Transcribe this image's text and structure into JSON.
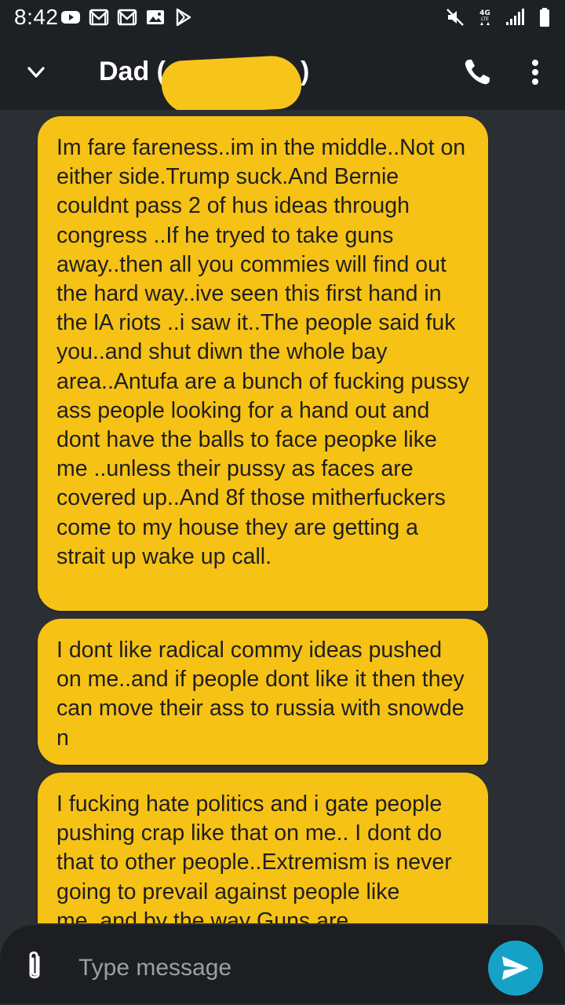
{
  "status_bar": {
    "time": "8:42",
    "left_icons": [
      "youtube-icon",
      "gmail-icon",
      "gmail-icon",
      "gallery-icon",
      "play-store-icon"
    ],
    "right_icons": [
      "mute-icon",
      "lte-icon",
      "signal-icon",
      "battery-icon"
    ]
  },
  "app_bar": {
    "title": "Dad (",
    "title_close": ")",
    "redaction_color": "#f7c41a"
  },
  "messages": [
    {
      "text": "Im fare fareness..im in the middle..Not on either side.Trump suck.And Bernie couldnt pass 2 of hus ideas through congress ..If he tryed to take guns away..then all you commies will find out the hard way..ive seen this first hand in the lA riots ..i saw it..The people said fuk you..and shut diwn the whole bay area..Antufa are a bunch of fucking pussy ass people looking for a hand out and dont have the balls to face peopke like me ..unless their pussy as faces are covered up..And 8f those mitherfuckers come to my house they are getting a strait up wake up call."
    },
    {
      "text": "I dont like radical commy ideas pushed on me..and if people dont like it then they can move their ass to russia with snowde n"
    },
    {
      "text": "I fucking hate politics and i gate people pushing crap like that on me.. I dont do that to other people..Extremism is never going to prevail against people like me..and by the way Guns are"
    }
  ],
  "composer": {
    "placeholder": "Type message"
  },
  "colors": {
    "bubble": "#f6c216",
    "send_button": "#16a2c7",
    "background": "#2b2e33",
    "bar": "#1e2124"
  }
}
